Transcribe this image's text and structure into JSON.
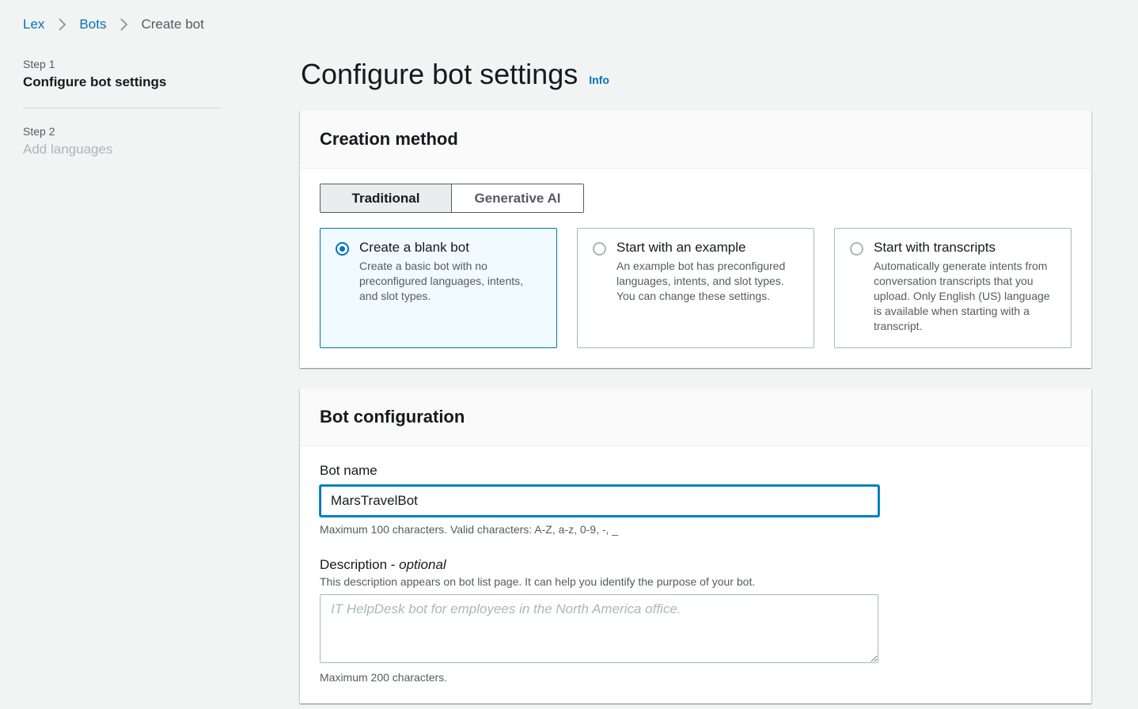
{
  "breadcrumb": {
    "items": [
      {
        "label": "Lex"
      },
      {
        "label": "Bots"
      }
    ],
    "current": "Create bot"
  },
  "steps": [
    {
      "number": "Step 1",
      "title": "Configure bot settings",
      "active": true
    },
    {
      "number": "Step 2",
      "title": "Add languages",
      "active": false
    }
  ],
  "page": {
    "title": "Configure bot settings",
    "info_link": "Info"
  },
  "creation_method": {
    "heading": "Creation method",
    "segments": [
      {
        "label": "Traditional",
        "selected": true
      },
      {
        "label": "Generative AI",
        "selected": false
      }
    ],
    "options": [
      {
        "title": "Create a blank bot",
        "description": "Create a basic bot with no preconfigured languages, intents, and slot types.",
        "selected": true
      },
      {
        "title": "Start with an example",
        "description": "An example bot has preconfigured languages, intents, and slot types. You can change these settings.",
        "selected": false
      },
      {
        "title": "Start with transcripts",
        "description": "Automatically generate intents from conversation transcripts that you upload. Only English (US) language is available when starting with a transcript.",
        "selected": false
      }
    ]
  },
  "bot_configuration": {
    "heading": "Bot configuration",
    "bot_name": {
      "label": "Bot name",
      "value": "MarsTravelBot",
      "constraint": "Maximum 100 characters. Valid characters: A-Z, a-z, 0-9, -, _"
    },
    "description": {
      "label": "Description - ",
      "label_optional": "optional",
      "help": "This description appears on bot list page. It can help you identify the purpose of your bot.",
      "placeholder": "IT HelpDesk bot for employees in the North America office.",
      "constraint": "Maximum 200 characters."
    }
  },
  "colors": {
    "link": "#0073bb",
    "background": "#f2f3f3",
    "selected_tile_bg": "#f1faff"
  }
}
